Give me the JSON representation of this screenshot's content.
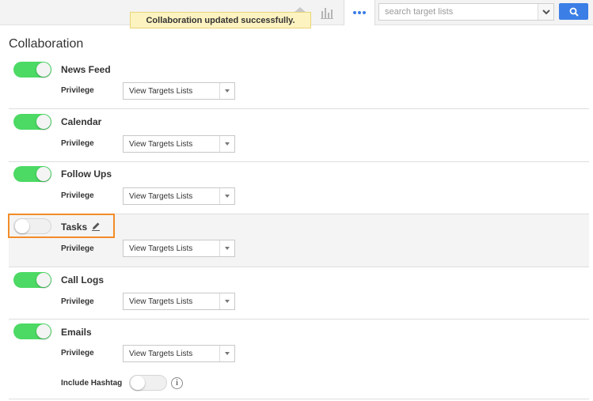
{
  "header": {
    "search": {
      "placeholder": "search target lists",
      "value": ""
    },
    "icons": {
      "home": "home-icon",
      "chart": "bar-chart-icon",
      "more": "more-dots-icon",
      "search": "search-icon"
    }
  },
  "toast": {
    "message": "Collaboration updated successfully."
  },
  "page": {
    "title": "Collaboration"
  },
  "sections": [
    {
      "title": "News Feed",
      "enabled": true,
      "privilege_label": "Privilege",
      "privilege_value": "View Targets Lists"
    },
    {
      "title": "Calendar",
      "enabled": true,
      "privilege_label": "Privilege",
      "privilege_value": "View Targets Lists"
    },
    {
      "title": "Follow Ups",
      "enabled": true,
      "privilege_label": "Privilege",
      "privilege_value": "View Targets Lists"
    },
    {
      "title": "Tasks",
      "enabled": false,
      "privilege_label": "Privilege",
      "privilege_value": "View Targets Lists"
    },
    {
      "title": "Call Logs",
      "enabled": true,
      "privilege_label": "Privilege",
      "privilege_value": "View Targets Lists"
    },
    {
      "title": "Emails",
      "enabled": true,
      "privilege_label": "Privilege",
      "privilege_value": "View Targets Lists",
      "hashtag_label": "Include Hashtag",
      "hashtag_enabled": false
    }
  ],
  "colors": {
    "toggle_on": "#4cd964",
    "accent": "#3b7ee6",
    "focus": "#f28c28",
    "toast_bg": "#fdf3c0"
  }
}
